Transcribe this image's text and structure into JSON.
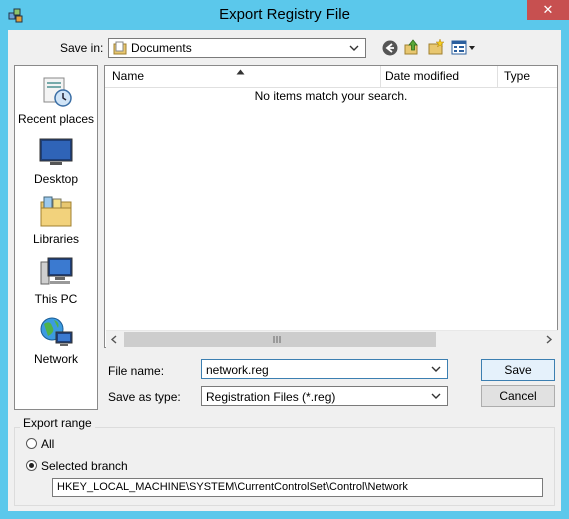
{
  "window": {
    "title": "Export Registry File",
    "close_glyph": "✕"
  },
  "save_in": {
    "label": "Save in:",
    "value": "Documents"
  },
  "nav_icons": [
    "back-icon",
    "up-folder-icon",
    "new-folder-icon",
    "view-menu-icon"
  ],
  "places": [
    {
      "label": "Recent places",
      "icon": "recent-places-icon"
    },
    {
      "label": "Desktop",
      "icon": "desktop-icon"
    },
    {
      "label": "Libraries",
      "icon": "libraries-icon"
    },
    {
      "label": "This PC",
      "icon": "this-pc-icon"
    },
    {
      "label": "Network",
      "icon": "network-icon"
    }
  ],
  "file_list": {
    "columns": [
      "Name",
      "Date modified",
      "Type"
    ],
    "empty_message": "No items match your search.",
    "sort_column": "Name",
    "sort_direction": "ascending"
  },
  "file_name": {
    "label": "File name:",
    "value": "network.reg"
  },
  "save_as_type": {
    "label": "Save as type:",
    "value": "Registration Files (*.reg)"
  },
  "buttons": {
    "save": "Save",
    "cancel": "Cancel"
  },
  "export_range": {
    "legend": "Export range",
    "options": [
      {
        "label": "All",
        "selected": false
      },
      {
        "label": "Selected branch",
        "selected": true
      }
    ],
    "branch_path": "HKEY_LOCAL_MACHINE\\SYSTEM\\CurrentControlSet\\Control\\Network"
  },
  "colors": {
    "title_bar": "#5bc8eb",
    "close_button": "#c75050",
    "dialog_bg": "#f0f0f0"
  }
}
